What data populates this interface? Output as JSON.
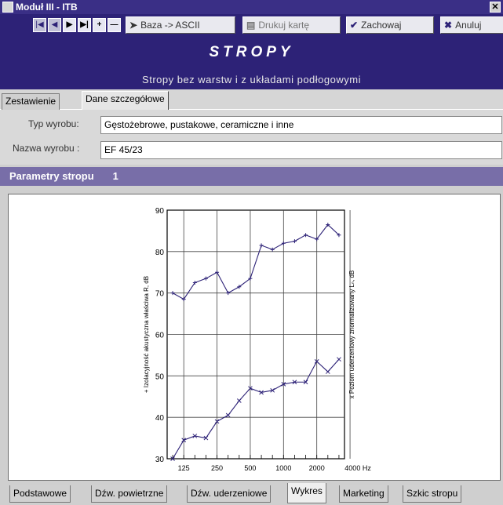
{
  "window": {
    "title": "Moduł III - ITB",
    "close_glyph": "✕"
  },
  "toolbar": {
    "nav": [
      "|◀",
      "◀",
      "▶",
      "▶|",
      "+",
      "—"
    ],
    "buttons": [
      {
        "icon": "➤",
        "label": "Baza -> ASCII"
      },
      {
        "icon": "▤",
        "label": "Drukuj kartę"
      },
      {
        "icon": "✔",
        "label": "Zachowaj"
      },
      {
        "icon": "✖",
        "label": "Anuluj"
      }
    ]
  },
  "header": {
    "title": "STROPY",
    "subtitle": "Stropy bez warstw i z układami podłogowymi"
  },
  "tabs": [
    "Zestawienie",
    "Dane szczegółowe"
  ],
  "form": {
    "type_label": "Typ wyrobu:",
    "type_value": "Gęstożebrowe, pustakowe, ceramiczne i inne",
    "name_label": "Nazwa wyrobu :",
    "name_value": "EF 45/23"
  },
  "params": {
    "label": "Parametry stropu",
    "number": "1"
  },
  "chart_data": {
    "type": "line",
    "x_ticks": [
      "125",
      "250",
      "500",
      "1000",
      "2000",
      "4000 Hz"
    ],
    "y_ticks": [
      "30",
      "40",
      "50",
      "60",
      "70",
      "80",
      "90"
    ],
    "ylim": [
      30,
      90
    ],
    "ylabel_left": "+ Izolacyjność akustyczna właściwa R, dB",
    "ylabel_right": "x Poziom uderzeniowy znormalizowany Lₙ, dB",
    "series": [
      {
        "marker": "+",
        "values": [
          70,
          68.5,
          72.5,
          73.5,
          75,
          70,
          71.5,
          73.5,
          81.5,
          80.5,
          82,
          82.5,
          84,
          83,
          86.5,
          84
        ]
      },
      {
        "marker": "x",
        "values": [
          30,
          34.5,
          35.5,
          35,
          39,
          40.5,
          44,
          47,
          46,
          46.5,
          48,
          48.5,
          48.5,
          53.5,
          51,
          54
        ]
      }
    ]
  },
  "bottom_tabs": [
    "Podstawowe",
    "Dźw. powietrzne",
    "Dźw. uderzeniowe",
    "Wykres",
    "Marketing",
    "Szkic stropu"
  ],
  "colors": {
    "title_bar": "#3a2f86",
    "header": "#2d2277",
    "params_bar": "#786ea8",
    "chart_line": "#2d2277"
  }
}
